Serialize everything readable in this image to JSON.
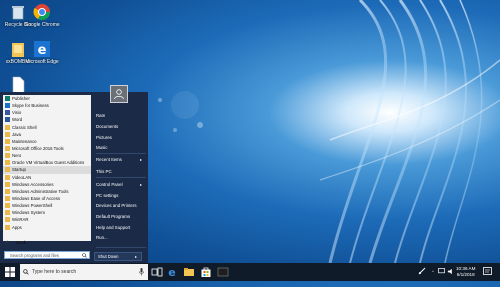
{
  "desktop": {
    "icons": [
      {
        "label": "Recycle Bin",
        "icon": "recycle-bin-icon"
      },
      {
        "label": "Google Chrome",
        "icon": "chrome-icon"
      },
      {
        "label": "xxBOMBxx",
        "icon": "folder-icon"
      },
      {
        "label": "Microsoft Edge",
        "icon": "edge-icon"
      },
      {
        "label": "",
        "icon": "document-icon"
      }
    ]
  },
  "start_menu": {
    "programs": [
      {
        "label": "Publisher",
        "icon": "publisher-icon",
        "color": "#0f7b6c"
      },
      {
        "label": "Skype for Business",
        "icon": "skype-icon",
        "color": "#1a6fc7"
      },
      {
        "label": "Visio",
        "icon": "visio-icon",
        "color": "#3955a3"
      },
      {
        "label": "Word",
        "icon": "word-icon",
        "color": "#2b579a"
      },
      {
        "label": "Classic Shell",
        "icon": "folder-icon",
        "color": "#e9b949"
      },
      {
        "label": "Java",
        "icon": "folder-icon",
        "color": "#e9b949"
      },
      {
        "label": "Maintenance",
        "icon": "folder-icon",
        "color": "#e9b949"
      },
      {
        "label": "Microsoft Office 2016 Tools",
        "icon": "folder-icon",
        "color": "#e9b949"
      },
      {
        "label": "Nero",
        "icon": "folder-icon",
        "color": "#e9b949"
      },
      {
        "label": "Oracle VM VirtualBox Guest Additions",
        "icon": "folder-icon",
        "color": "#e9b949"
      },
      {
        "label": "Startup",
        "icon": "folder-icon",
        "color": "#e9b949",
        "selected": true
      },
      {
        "label": "VideoLAN",
        "icon": "folder-icon",
        "color": "#e9b949"
      },
      {
        "label": "Windows Accessories",
        "icon": "folder-icon",
        "color": "#e9b949"
      },
      {
        "label": "Windows Administrative Tools",
        "icon": "folder-icon",
        "color": "#e9b949"
      },
      {
        "label": "Windows Ease of Access",
        "icon": "folder-icon",
        "color": "#e9b949"
      },
      {
        "label": "Windows PowerShell",
        "icon": "folder-icon",
        "color": "#e9b949"
      },
      {
        "label": "Windows System",
        "icon": "folder-icon",
        "color": "#e9b949"
      },
      {
        "label": "WinRAR",
        "icon": "folder-icon",
        "color": "#e9b949"
      },
      {
        "label": "Apps",
        "icon": "folder-icon",
        "color": "#e9b949"
      }
    ],
    "back_label": "Back",
    "search_placeholder": "Search programs and files",
    "right_items": [
      {
        "label": "Ram",
        "arrow": false
      },
      {
        "label": "Documents",
        "arrow": false
      },
      {
        "label": "Pictures",
        "arrow": false
      },
      {
        "label": "Music",
        "arrow": false
      },
      {
        "label": "Recent Items",
        "arrow": true
      },
      {
        "label": "This PC",
        "arrow": false
      },
      {
        "label": "Control Panel",
        "arrow": true
      },
      {
        "label": "PC settings",
        "arrow": false
      },
      {
        "label": "Devices and Printers",
        "arrow": false
      },
      {
        "label": "Default Programs",
        "arrow": false
      },
      {
        "label": "Help and Support",
        "arrow": false
      },
      {
        "label": "Run...",
        "arrow": false
      }
    ],
    "shutdown_label": "Shut Down",
    "shutdown_arrow": "▸"
  },
  "taskbar": {
    "search_placeholder": "Type here to search",
    "clock_time": "10:36 AM",
    "clock_date": "6/1/2018"
  }
}
